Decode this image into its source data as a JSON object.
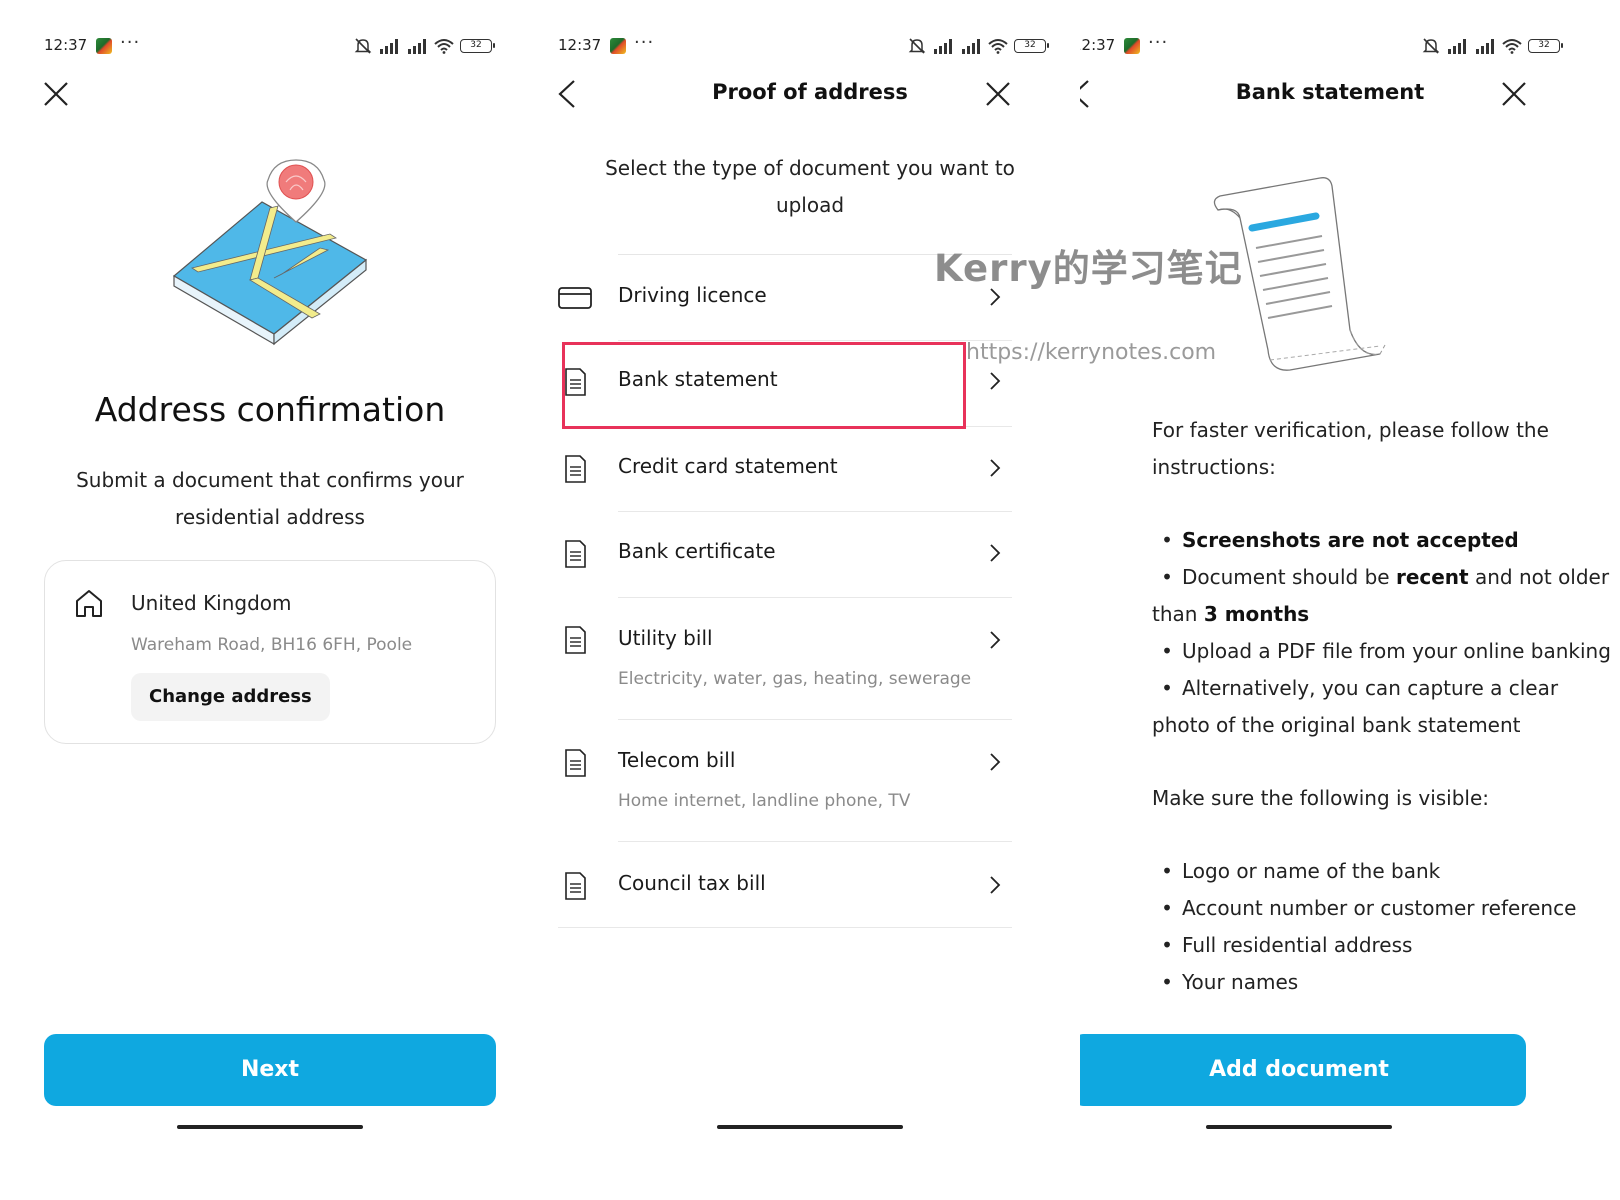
{
  "status": {
    "time": "12:37",
    "battery": "32"
  },
  "screen1": {
    "title": "Address confirmation",
    "subtitle": "Submit a document that confirms your residential address",
    "address_card": {
      "country": "United Kingdom",
      "address": "Wareham Road, BH16 6FH, Poole",
      "change_label": "Change address"
    },
    "next_label": "Next"
  },
  "screen2": {
    "title": "Proof of address",
    "intro_line1": "Select the type of document you want to",
    "intro_line2": "upload",
    "items": [
      {
        "label": "Driving licence",
        "sub": ""
      },
      {
        "label": "Bank statement",
        "sub": ""
      },
      {
        "label": "Credit card statement",
        "sub": ""
      },
      {
        "label": "Bank certificate",
        "sub": ""
      },
      {
        "label": "Utility bill",
        "sub": "Electricity, water, gas, heating, sewerage"
      },
      {
        "label": "Telecom bill",
        "sub": "Home internet, landline phone, TV"
      },
      {
        "label": "Council tax bill",
        "sub": ""
      }
    ]
  },
  "watermark": {
    "text": "Kerry的学习笔记",
    "url": "https://kerrynotes.com"
  },
  "screen3": {
    "title": "Bank statement",
    "intro": "For faster verification, please follow the instructions:",
    "instr": {
      "i1": "Screenshots are not accepted",
      "i2_a": "Document should be",
      "i2_b": "recent",
      "i2_c": "and not older than",
      "i2_d": "3 months",
      "i3": "Upload a PDF file from your online banking",
      "i4": "Alternatively, you can capture a clear photo of the original bank statement"
    },
    "visible_heading": "Make sure the following is visible:",
    "visible_items": [
      "Logo or name of the bank",
      "Account number or customer reference",
      "Full residential address",
      "Your names"
    ],
    "add_label": "Add document"
  },
  "colors": {
    "primary": "#0fa8e0",
    "highlight": "#e8325a",
    "muted": "#8a8a8a"
  }
}
